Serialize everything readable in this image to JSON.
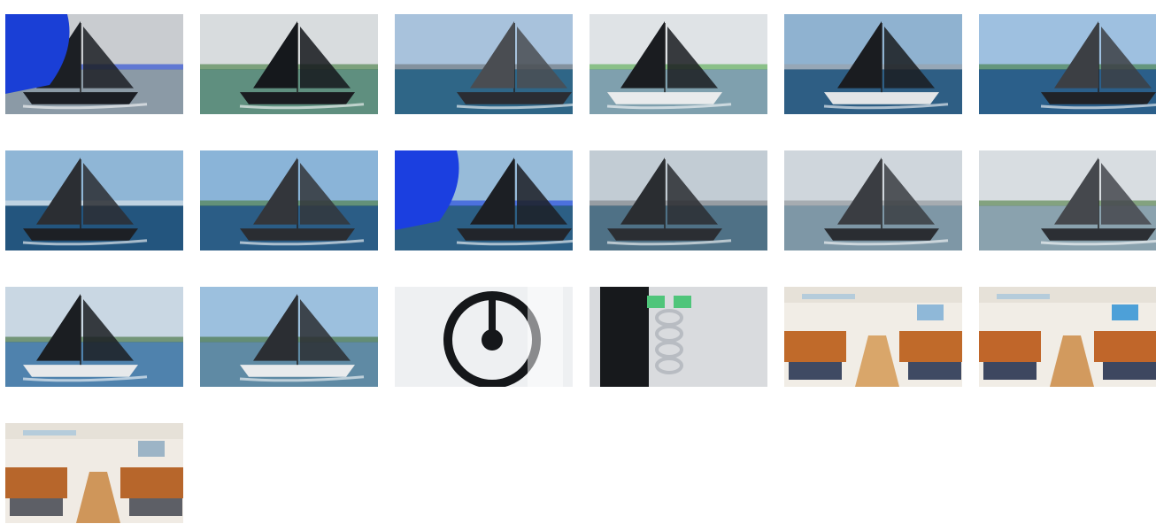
{
  "gallery": {
    "thumbnails": [
      {
        "subject": "sailboat-blue-spinnaker",
        "scene": "sailing",
        "colors": {
          "sky": "#c9ccd0",
          "water": "#8b9aa6",
          "sail": "#1c1f24",
          "accent": "#1a3fd6",
          "hull": "#1b1e24"
        }
      },
      {
        "subject": "sailboat-dark-sails-shore",
        "scene": "sailing",
        "colors": {
          "sky": "#d8dcde",
          "water": "#5f8f7f",
          "sail": "#15181c",
          "accent": "#3f7a3a",
          "hull": "#1a1c20"
        }
      },
      {
        "subject": "sailboat-grey-sails",
        "scene": "sailing",
        "colors": {
          "sky": "#a8c2dc",
          "water": "#2f6687",
          "sail": "#4a4d52",
          "accent": "#6b6f75",
          "hull": "#2a2d33"
        }
      },
      {
        "subject": "sailboat-white-jib",
        "scene": "sailing",
        "colors": {
          "sky": "#dfe3e6",
          "water": "#7fa0ae",
          "sail": "#1a1c20",
          "accent": "#52a84a",
          "hull": "#e9ebec"
        }
      },
      {
        "subject": "sailboat-crew-on-deck",
        "scene": "sailing",
        "colors": {
          "sky": "#8fb2d0",
          "water": "#2e5e84",
          "sail": "#1a1c20",
          "accent": "#9ba0a6",
          "hull": "#e3e5e7"
        }
      },
      {
        "subject": "sailboat-bow-closeup",
        "scene": "sailing",
        "colors": {
          "sky": "#9ec0e0",
          "water": "#2b5f8a",
          "sail": "#3c3f44",
          "accent": "#3e7a3a",
          "hull": "#202328"
        }
      },
      {
        "subject": "sailboat-heeling-waves",
        "scene": "sailing",
        "colors": {
          "sky": "#8fb6d6",
          "water": "#23557e",
          "sail": "#2b2e33",
          "accent": "#dfe6ea",
          "hull": "#1d2025"
        }
      },
      {
        "subject": "sailboat-bow-on-waves",
        "scene": "sailing",
        "colors": {
          "sky": "#8ab4d8",
          "water": "#2b5d86",
          "sail": "#33363b",
          "accent": "#4a7a3a",
          "hull": "#2a2d32"
        }
      },
      {
        "subject": "sailboat-blue-spinnaker-wide",
        "scene": "sailing",
        "colors": {
          "sky": "#97bbd9",
          "water": "#2c5f85",
          "sail": "#1c1f24",
          "accent": "#1b3fe0",
          "hull": "#22252b"
        }
      },
      {
        "subject": "sailboat-crew-rail",
        "scene": "sailing",
        "colors": {
          "sky": "#c2ccd4",
          "water": "#4f7186",
          "sail": "#2a2d31",
          "accent": "#7a7d82",
          "hull": "#2b2e33"
        }
      },
      {
        "subject": "sailboat-cockpit-crew",
        "scene": "sailing",
        "colors": {
          "sky": "#cfd6dc",
          "water": "#7e97a6",
          "sail": "#3a3d42",
          "accent": "#8b8f95",
          "hull": "#2a2d32"
        }
      },
      {
        "subject": "sailboat-sideview",
        "scene": "sailing",
        "colors": {
          "sky": "#d8dde1",
          "water": "#8aa2ae",
          "sail": "#45484d",
          "accent": "#4b7c3d",
          "hull": "#2c2f34"
        }
      },
      {
        "subject": "sailboat-tree-shoreline",
        "scene": "sailing",
        "colors": {
          "sky": "#c9d7e3",
          "water": "#4f82ad",
          "sail": "#1b1e22",
          "accent": "#3a6a30",
          "hull": "#e7e9eb"
        }
      },
      {
        "subject": "sailboat-rocky-shore",
        "scene": "sailing",
        "colors": {
          "sky": "#9cc0de",
          "water": "#5f8aa4",
          "sail": "#2b2e33",
          "accent": "#3d6b2e",
          "hull": "#e9ebed"
        }
      },
      {
        "subject": "helm-wheel-detail",
        "scene": "detail",
        "colors": {
          "bg": "#eef0f2",
          "main": "#15171a",
          "accent": "#c9ccd0"
        }
      },
      {
        "subject": "chain-shackle-detail",
        "scene": "detail",
        "colors": {
          "bg": "#d9dbde",
          "main": "#17191c",
          "accent": "#4fc57a"
        }
      },
      {
        "subject": "cabin-interior-saloon",
        "scene": "interior",
        "colors": {
          "bg": "#f1ede6",
          "wood": "#c06a2a",
          "floor": "#d9a66a",
          "upholstery": "#3f4a63",
          "accent": "#8fb8d8"
        }
      },
      {
        "subject": "cabin-interior-navstation",
        "scene": "interior",
        "colors": {
          "bg": "#f1ede6",
          "wood": "#c0662a",
          "floor": "#d29a5e",
          "upholstery": "#3d4760",
          "accent": "#4da0d8"
        }
      },
      {
        "subject": "galley-interior",
        "scene": "interior",
        "colors": {
          "bg": "#f0ebe4",
          "wood": "#b7662b",
          "floor": "#cf965a",
          "upholstery": "#5d5f66",
          "accent": "#9cb4c6"
        }
      }
    ]
  }
}
